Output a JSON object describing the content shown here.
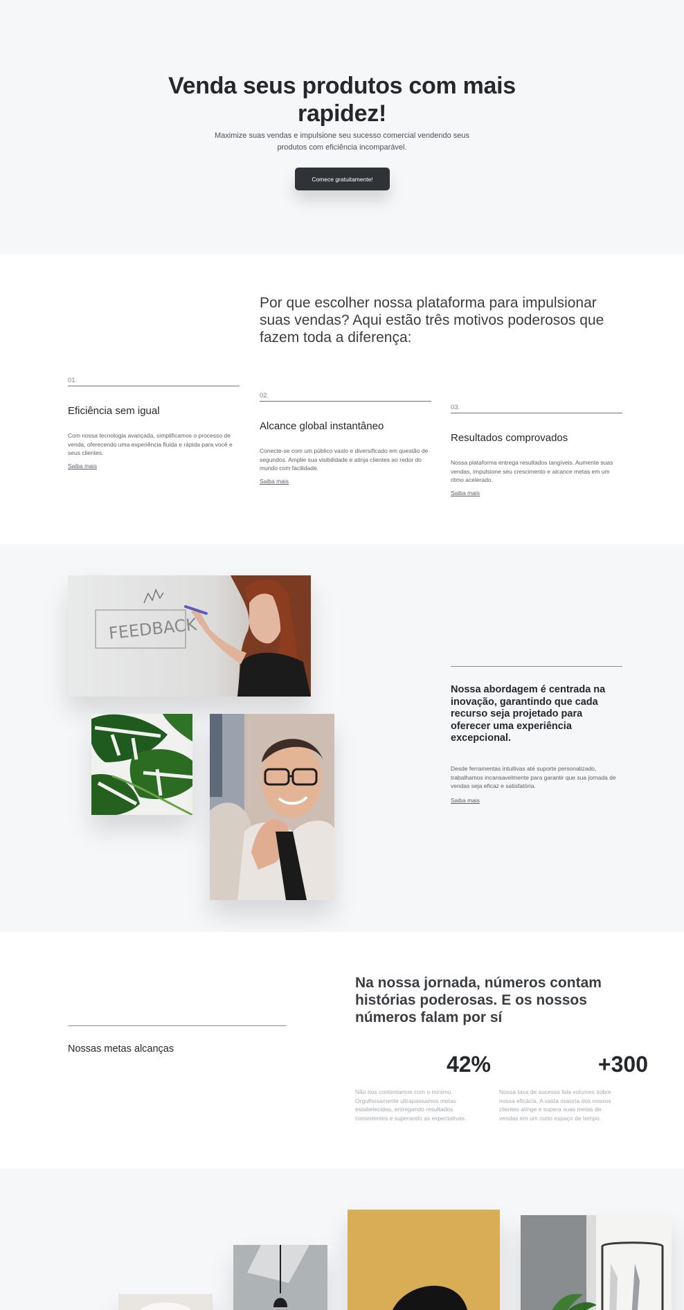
{
  "hero": {
    "title": "Venda seus produtos com mais rapidez!",
    "subtitle": "Maximize suas vendas e impulsione seu sucesso comercial vendendo seus produtos com eficiência incomparável.",
    "cta_label": "Comece gratuitamente!"
  },
  "motivos": {
    "heading": "Por que escolher nossa plataforma para impulsionar suas vendas? Aqui estão três motivos poderosos que fazem toda a diferença:",
    "items": [
      {
        "number": "01.",
        "title": "Eficiência sem igual",
        "description": "Com nossa tecnologia avançada, simplificamos o processo de venda, oferecendo uma experiência fluida e rápida para você e seus clientes.",
        "link": "Saiba mais"
      },
      {
        "number": "02.",
        "title": "Alcance global instantâneo",
        "description": "Conecte-se com um público vasto e diversificado em questão de segundos. Amplie sua visibilidade e atinja clientes ao redor do mundo com facilidade.",
        "link": "Saiba mais"
      },
      {
        "number": "03.",
        "title": "Resultados comprovados",
        "description": "Nossa plataforma entrega resultados tangíveis. Aumente suas vendas, impulsione seu crescimento e alcance metas em um ritmo acelerado.",
        "link": "Saiba mais"
      }
    ]
  },
  "abordagem": {
    "title": "Nossa abordagem é centrada na inovação, garantindo que cada recurso seja projetado para oferecer uma experiência excepcional.",
    "description": "Desde ferramentas intuitivas até suporte personalizado, trabalhamos incansavelmente para garantir que sua jornada de vendas seja eficaz e satisfatória.",
    "link": "Saiba mais",
    "photos": [
      "whiteboard-photo",
      "monstera-leaf-photo",
      "smiling-man-photo"
    ]
  },
  "numeros": {
    "label": "Nossas metas alcanças",
    "heading": "Na nossa jornada, números contam histórias poderosas. E os nossos números falam por sí",
    "stats": [
      {
        "value": "42%",
        "description": "Não nos contentamos com o mínimo. Orgulhosamente ultrapassamos metas estabelecidas, entregando resultados consistentes e superando as expectativas."
      },
      {
        "value": "+300",
        "description": "Nossa taxa de sucesso fala volumes sobre nossa eficácia. A vasta maioria dos nossos clientes atinge e supera suas metas de vendas em um curto espaço de tempo."
      }
    ]
  },
  "colors": {
    "background_light": "#f6f7f9",
    "text_dark": "#24272c",
    "button_dark": "#2f3237",
    "accent_mustard": "#d9ad55"
  }
}
